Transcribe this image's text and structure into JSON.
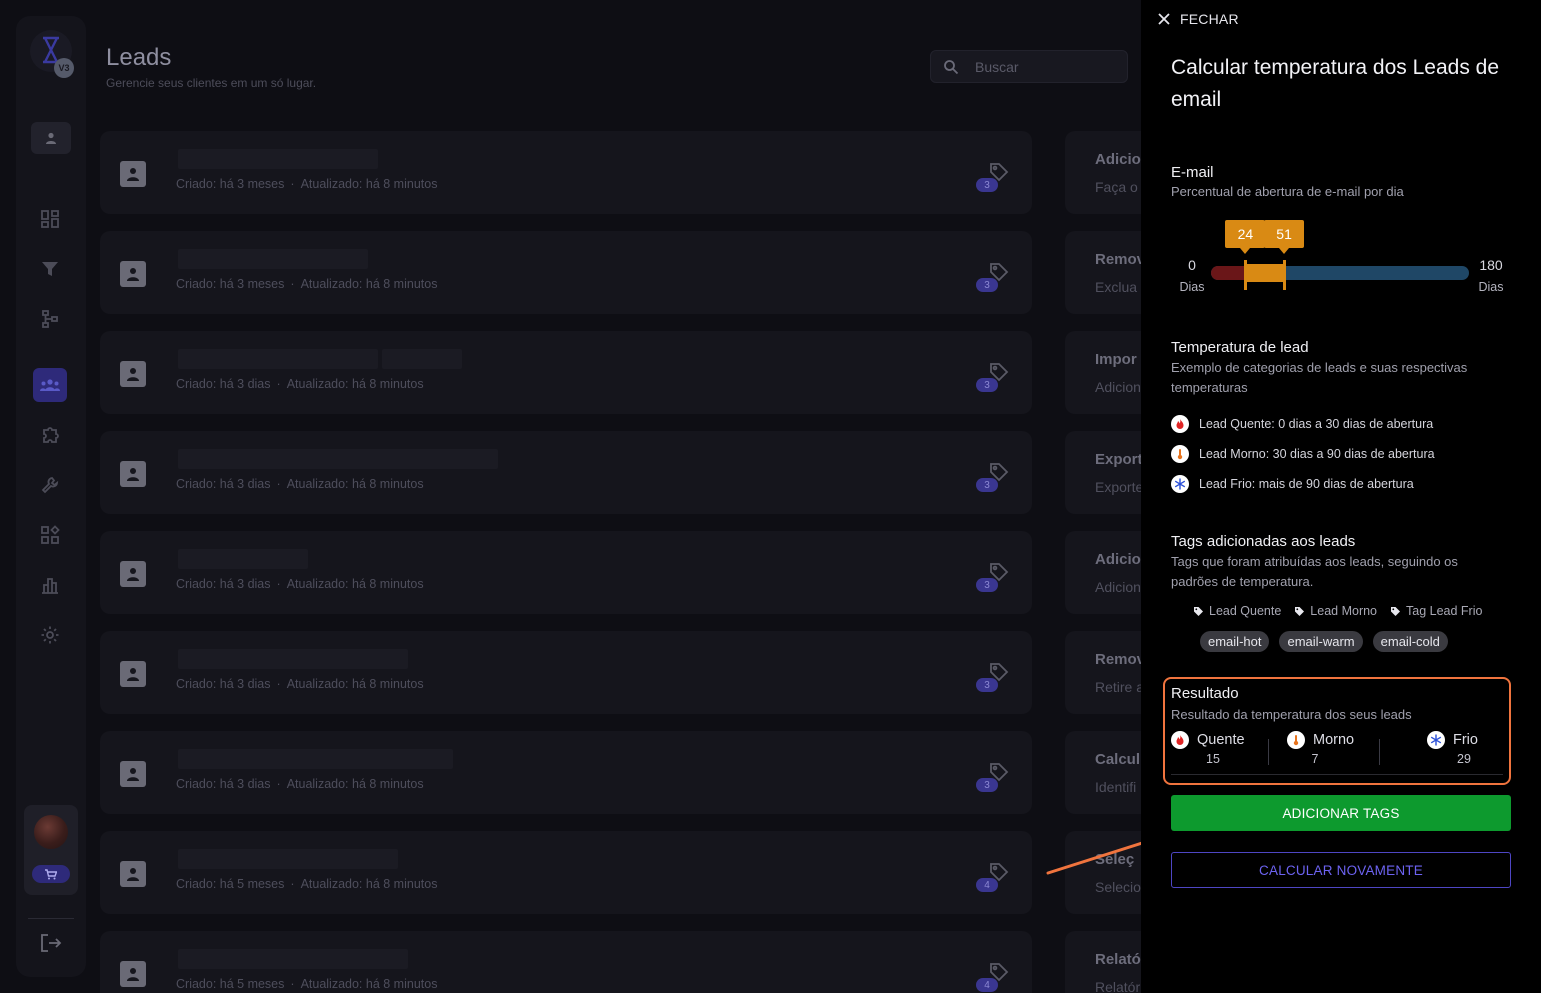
{
  "app": {
    "version_badge": "V3",
    "page_title": "Leads",
    "page_subtitle": "Gerencie seus clientes em um só lugar.",
    "search_placeholder": "Buscar",
    "lead_cards": [
      {
        "created": "Criado: há 3 meses",
        "updated": "Atualizado: há 8 minutos",
        "tags_count": "3"
      },
      {
        "created": "Criado: há 3 meses",
        "updated": "Atualizado: há 8 minutos",
        "tags_count": "3"
      },
      {
        "created": "Criado: há 3 dias",
        "updated": "Atualizado: há 8 minutos",
        "tags_count": "3"
      },
      {
        "created": "Criado: há 3 dias",
        "updated": "Atualizado: há 8 minutos",
        "tags_count": "3"
      },
      {
        "created": "Criado: há 3 dias",
        "updated": "Atualizado: há 8 minutos",
        "tags_count": "3"
      },
      {
        "created": "Criado: há 3 dias",
        "updated": "Atualizado: há 8 minutos",
        "tags_count": "3"
      },
      {
        "created": "Criado: há 3 dias",
        "updated": "Atualizado: há 8 minutos",
        "tags_count": "3"
      },
      {
        "created": "Criado: há 5 meses",
        "updated": "Atualizado: há 8 minutos",
        "tags_count": "4"
      },
      {
        "created": "Criado: há 5 meses",
        "updated": "Atualizado: há 8 minutos",
        "tags_count": "4"
      }
    ],
    "action_cards": [
      {
        "title": "Adicio",
        "desc": "Faça o"
      },
      {
        "title": "Remov",
        "desc": "Exclua"
      },
      {
        "title": "Impor",
        "desc": "Adicion"
      },
      {
        "title": "Export",
        "desc": "Exporte"
      },
      {
        "title": "Adicio",
        "desc": "Adicion"
      },
      {
        "title": "Remov",
        "desc": "Retire a"
      },
      {
        "title": "Calcul",
        "desc": "Identifi"
      },
      {
        "title": "Seleç",
        "desc": "Selecio"
      },
      {
        "title": "Relató",
        "desc": "Relatór"
      }
    ],
    "sidebar_icons": [
      "dashboard-icon",
      "filter-icon",
      "flow-icon",
      "users-icon",
      "puzzle-icon",
      "wrench-icon",
      "apps-icon",
      "chart-icon",
      "gear-icon"
    ]
  },
  "drawer": {
    "close_label": "FECHAR",
    "title": "Calcular temperatura dos Leads de email",
    "email": {
      "title": "E-mail",
      "subtitle": "Percentual de abertura de e-mail por dia",
      "slider": {
        "min": "0",
        "max": "180",
        "min_unit": "Dias",
        "max_unit": "Dias",
        "low": "24",
        "high": "51",
        "low_value": 24,
        "high_value": 51,
        "range_max": 180
      }
    },
    "temperature": {
      "title": "Temperatura de lead",
      "subtitle": "Exemplo de categorias de leads e suas respectivas temperaturas",
      "items": [
        {
          "label": "Lead Quente: 0 dias a 30 dias de abertura",
          "icon": "fire-icon",
          "color": "#e02424"
        },
        {
          "label": "Lead Morno: 30 dias a 90 dias de abertura",
          "icon": "thermometer-icon",
          "color": "#e8741e"
        },
        {
          "label": "Lead Frio: mais de 90 dias de abertura",
          "icon": "snowflake-icon",
          "color": "#2a4fd8"
        }
      ]
    },
    "tags": {
      "title": "Tags adicionadas aos leads",
      "subtitle": "Tags que foram atribuídas aos leads, seguindo os padrões de temperatura.",
      "labels": [
        "Lead Quente",
        "Lead Morno",
        "Tag Lead Frio"
      ],
      "chips": [
        "email-hot",
        "email-warm",
        "email-cold"
      ]
    },
    "result": {
      "title": "Resultado",
      "subtitle": "Resultado da temperatura dos seus leads",
      "columns": [
        {
          "label": "Quente",
          "value": "15",
          "icon": "fire-icon"
        },
        {
          "label": "Morno",
          "value": "7",
          "icon": "thermometer-icon"
        },
        {
          "label": "Frio",
          "value": "29",
          "icon": "snowflake-icon"
        }
      ]
    },
    "add_tags_label": "ADICIONAR TAGS",
    "recalculate_label": "CALCULAR NOVAMENTE"
  },
  "colors": {
    "accent_orange": "#f0743e",
    "primary_green": "#0d9a2e",
    "outline_purple": "#6d63f2",
    "slider_amber": "#d98a14"
  }
}
